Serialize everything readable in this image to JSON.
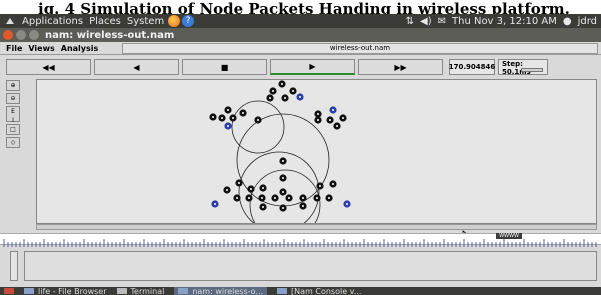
{
  "caption": {
    "text": "ig. 4 Simulation of Node Packets Handing in wireless platform."
  },
  "top_panel": {
    "menus": [
      "Applications",
      "Places",
      "System"
    ],
    "datetime": "Thu Nov  3, 12:10 AM",
    "user": "jdrd"
  },
  "window": {
    "title": "nam: wireless-out.nam"
  },
  "menubar": {
    "items": [
      "File",
      "Views",
      "Analysis"
    ],
    "file_label": "wireless-out.nam"
  },
  "controls": {
    "rewind": "◀◀",
    "back": "◀",
    "stop": "■",
    "play": "▶",
    "fast_forward": "▶▶",
    "time": "170.904846",
    "step": "Step: 50.1ms"
  },
  "ruler": {
    "marker": "WWWW"
  },
  "taskbar": {
    "items": [
      "life - File Browser",
      "Terminal",
      "nam: wireless-o...",
      "[Nam Console v..."
    ]
  },
  "icons": [
    "firefox-icon",
    "help-icon",
    "network-icon",
    "volume-icon",
    "mail-icon",
    "user-icon"
  ],
  "colors": {
    "panel": "#3b3b38",
    "canvas": "#e6e6e6",
    "node": "#111111",
    "highlight_node": "#2d3ea8",
    "close_button": "#e25a2e"
  }
}
